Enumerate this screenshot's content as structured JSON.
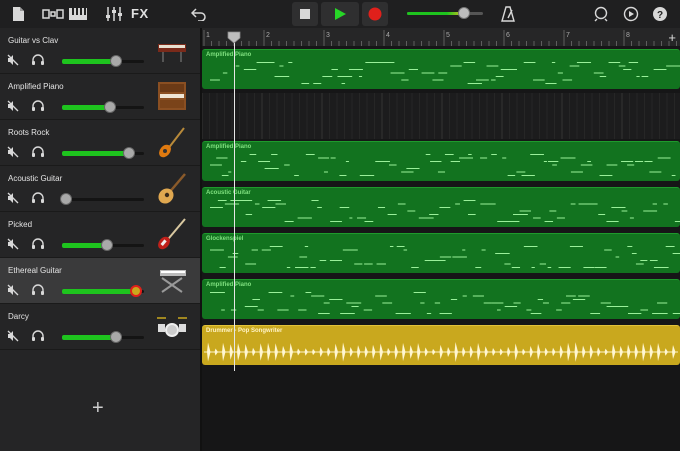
{
  "toolbar": {
    "fx_label": "FX",
    "icons": [
      "document-icon",
      "views-icon",
      "keyboard-icon",
      "mixer-icon",
      "undo-icon",
      "stop-icon",
      "play-icon",
      "record-icon",
      "metronome-icon",
      "loop-icon",
      "settings-icon",
      "help-icon"
    ],
    "master_volume": 0.75,
    "accent_green": "#1ec41e",
    "record_red": "#e0201b"
  },
  "ruler": {
    "bars": [
      "1",
      "2",
      "3",
      "4",
      "5",
      "6",
      "7",
      "8"
    ],
    "add_label": "+"
  },
  "tracks": [
    {
      "name": "Guitar vs Clav",
      "volume": 0.66,
      "instrument": "clavinet-icon",
      "selected": false
    },
    {
      "name": "Amplified Piano",
      "volume": 0.59,
      "instrument": "upright-piano-icon",
      "selected": false
    },
    {
      "name": "Roots Rock",
      "volume": 0.82,
      "instrument": "electric-guitar-icon",
      "selected": false
    },
    {
      "name": "Acoustic Guitar",
      "volume": 0.05,
      "instrument": "acoustic-guitar-icon",
      "selected": false
    },
    {
      "name": "Picked",
      "volume": 0.55,
      "instrument": "bass-guitar-icon",
      "selected": false
    },
    {
      "name": "Ethereal Guitar",
      "volume": 0.9,
      "instrument": "keyboard-stand-icon",
      "selected": true
    },
    {
      "name": "Darcy",
      "volume": 0.66,
      "instrument": "drum-kit-icon",
      "selected": false
    }
  ],
  "add_track_label": "+",
  "regions": [
    {
      "lane": 0,
      "label": "Amplified Piano",
      "kind": "midi"
    },
    {
      "lane": 2,
      "label": "Amplified Piano",
      "kind": "midi"
    },
    {
      "lane": 3,
      "label": "Acoustic Guitar",
      "kind": "midi"
    },
    {
      "lane": 4,
      "label": "Glockenspiel",
      "kind": "midi"
    },
    {
      "lane": 5,
      "label": "Amplified Piano",
      "kind": "midi"
    },
    {
      "lane": 6,
      "label": "Drummer - Pop Songwriter",
      "kind": "drum"
    }
  ]
}
